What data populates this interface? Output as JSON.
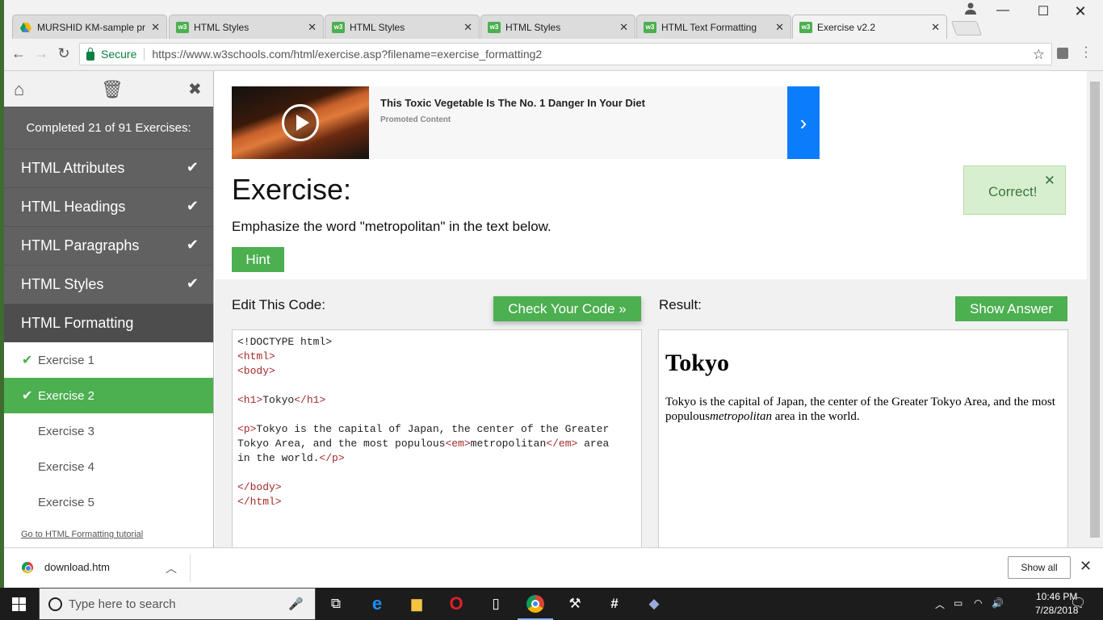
{
  "browser": {
    "tabs": [
      {
        "title": "MURSHID KM-sample pr",
        "icon": "google-drive-icon"
      },
      {
        "title": "HTML Styles",
        "icon": "w3-icon"
      },
      {
        "title": "HTML Styles",
        "icon": "w3-icon"
      },
      {
        "title": "HTML Styles",
        "icon": "w3-icon"
      },
      {
        "title": "HTML Text Formatting",
        "icon": "w3-icon"
      },
      {
        "title": "Exercise v2.2",
        "icon": "w3-icon",
        "active": true
      }
    ],
    "secure_label": "Secure",
    "url": "https://www.w3schools.com/html/exercise.asp?filename=exercise_formatting2"
  },
  "sidebar": {
    "completed": "Completed 21 of 91 Exercises:",
    "topics": [
      {
        "label": "HTML Attributes",
        "done": true
      },
      {
        "label": "HTML Headings",
        "done": true
      },
      {
        "label": "HTML Paragraphs",
        "done": true
      },
      {
        "label": "HTML Styles",
        "done": true
      },
      {
        "label": "HTML Formatting",
        "done": false
      }
    ],
    "exercises": [
      {
        "label": "Exercise 1",
        "done": true
      },
      {
        "label": "Exercise 2",
        "done": true,
        "active": true
      },
      {
        "label": "Exercise 3",
        "done": false
      },
      {
        "label": "Exercise 4",
        "done": false
      },
      {
        "label": "Exercise 5",
        "done": false
      }
    ],
    "tutorial_link": "Go to HTML Formatting tutorial"
  },
  "ad": {
    "title": "This Toxic Vegetable Is The No. 1 Danger In Your Diet",
    "subtitle": "Promoted Content"
  },
  "exercise": {
    "title": "Exercise:",
    "description": "Emphasize the word \"metropolitan\" in the text below.",
    "hint": "Hint",
    "correct": "Correct!",
    "edit_label": "Edit This Code:",
    "check_button": "Check Your Code »",
    "result_label": "Result:",
    "show_answer": "Show Answer"
  },
  "code": {
    "doctype": "<!DOCTYPE html>",
    "html_open": "<html>",
    "body_open": "<body>",
    "h1_open": "<h1>",
    "h1_text": "Tokyo",
    "h1_close": "</h1>",
    "p_open": "<p>",
    "p_text_1": "Tokyo is the capital of Japan, the center of the Greater",
    "p_text_2": "Tokyo Area, and the most populous",
    "em_open": "<em>",
    "em_text": "metropolitan",
    "em_close": "</em>",
    "p_text_3": " area",
    "p_text_4": "in the world.",
    "p_close": "</p>",
    "body_close": "</body>",
    "html_close": "</html>"
  },
  "result": {
    "heading": "Tokyo",
    "text_before": "Tokyo is the capital of Japan, the center of the Greater Tokyo Area, and the most populous",
    "em_text": "metropolitan",
    "text_after": " area in the world."
  },
  "download": {
    "file": "download.htm",
    "show_all": "Show all"
  },
  "taskbar": {
    "search_placeholder": "Type here to search",
    "time": "10:46 PM",
    "date": "7/28/2018"
  }
}
